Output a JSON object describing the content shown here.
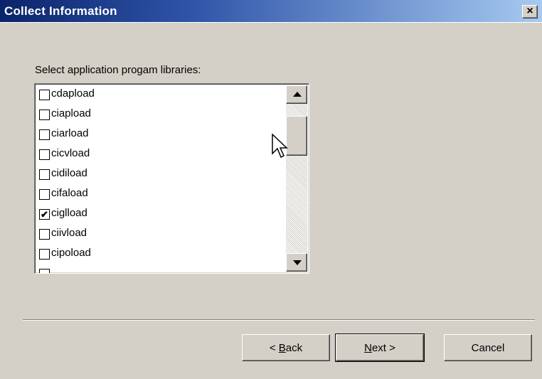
{
  "window": {
    "title": "Collect Information",
    "close_label": "×"
  },
  "prompt": "Select application progam libraries:",
  "list": {
    "items": [
      {
        "label": "cdapload",
        "checked": false
      },
      {
        "label": "ciapload",
        "checked": false
      },
      {
        "label": "ciarload",
        "checked": false
      },
      {
        "label": "cicvload",
        "checked": false
      },
      {
        "label": "cidiload",
        "checked": false
      },
      {
        "label": "cifaload",
        "checked": false
      },
      {
        "label": "ciglload",
        "checked": true
      },
      {
        "label": "ciivload",
        "checked": false
      },
      {
        "label": "cipoload",
        "checked": false
      }
    ],
    "scroll_position": 0.1
  },
  "buttons": {
    "back": {
      "prefix": "< ",
      "accel": "B",
      "rest": "ack"
    },
    "next": {
      "accel": "N",
      "rest": "ext >"
    },
    "cancel": "Cancel"
  },
  "icons": {
    "cursor": "mouse-pointer-icon",
    "check": "✔"
  }
}
